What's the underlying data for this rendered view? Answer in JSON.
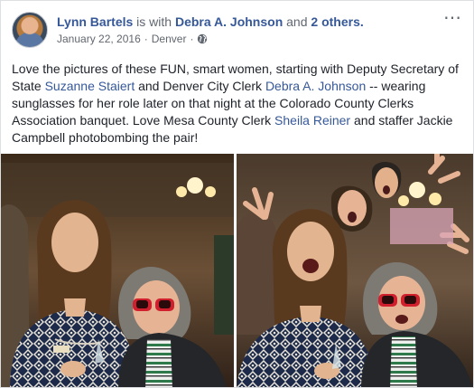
{
  "post": {
    "author": "Lynn Bartels",
    "with_prefix": "is with",
    "tagged_person": "Debra A. Johnson",
    "and_text": "and",
    "others_count_text": "2 others.",
    "date": "January 22, 2016",
    "separator": "·",
    "location": "Denver",
    "separator2": "·",
    "more_icon": "⋯",
    "text_segments": [
      {
        "type": "text",
        "value": "Love the pictures of these FUN, smart women, starting with Deputy Secretary of State "
      },
      {
        "type": "link",
        "value": "Suzanne Staiert"
      },
      {
        "type": "text",
        "value": " and Denver City Clerk "
      },
      {
        "type": "link",
        "value": "Debra A. Johnson"
      },
      {
        "type": "text",
        "value": " -- wearing sunglasses for her role later on that night at the Colorado County Clerks Association banquet. Love Mesa County Clerk "
      },
      {
        "type": "link",
        "value": "Sheila Reiner"
      },
      {
        "type": "text",
        "value": " and staffer Jackie Campbell photobombing the pair!"
      }
    ]
  },
  "colors": {
    "link": "#365899",
    "meta": "#616770",
    "text": "#1d2129",
    "card_border": "#dddfe2"
  },
  "icons": {
    "avatar": "profile-photo",
    "privacy": "globe-icon",
    "options": "more-options-icon"
  }
}
